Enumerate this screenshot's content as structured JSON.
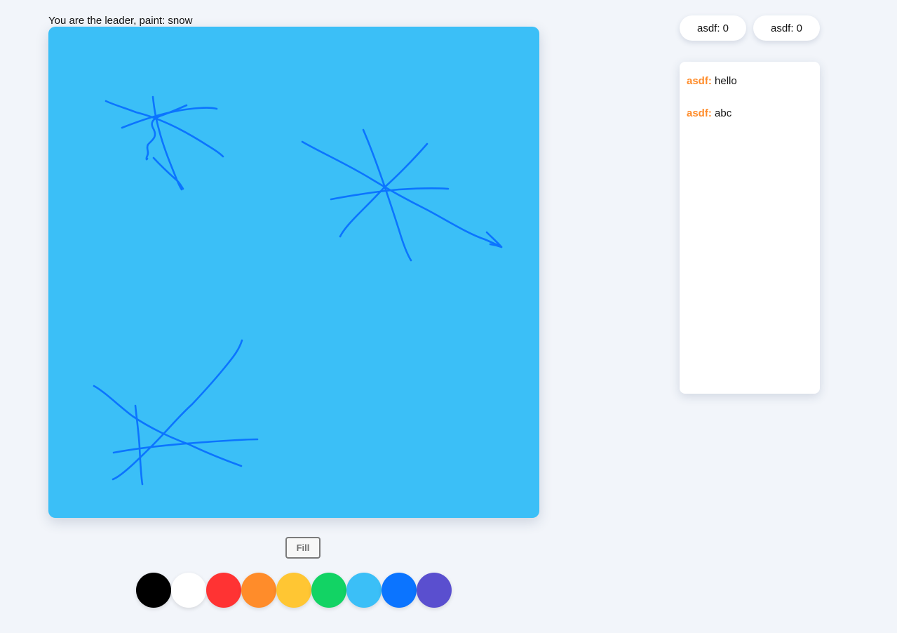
{
  "game": {
    "prompt": "You are the leader, paint: snow",
    "fill_label": "Fill",
    "canvas_background": "#3bbff7",
    "stroke_color": "#0b74ff"
  },
  "palette": [
    {
      "name": "black",
      "color": "#000000"
    },
    {
      "name": "white",
      "color": "#ffffff"
    },
    {
      "name": "red",
      "color": "#ff3333"
    },
    {
      "name": "orange",
      "color": "#ff8c2a"
    },
    {
      "name": "yellow",
      "color": "#ffc633"
    },
    {
      "name": "green",
      "color": "#12d364"
    },
    {
      "name": "sky-blue",
      "color": "#3bbff7"
    },
    {
      "name": "blue",
      "color": "#0b74ff"
    },
    {
      "name": "purple",
      "color": "#5a4fcf"
    }
  ],
  "scores": [
    {
      "label": "asdf: 0"
    },
    {
      "label": "asdf: 0"
    }
  ],
  "chat": {
    "messages": [
      {
        "author": "asdf:",
        "text": "hello"
      },
      {
        "author": "asdf:",
        "text": "abc"
      }
    ]
  }
}
